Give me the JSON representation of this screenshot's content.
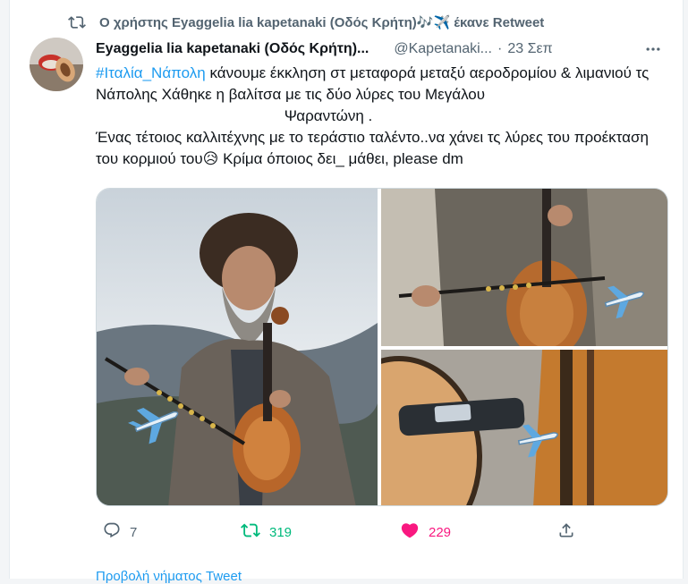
{
  "retweet_banner": {
    "text": "Ο χρήστης Eyaggelia lia kapetanaki (Οδός Κρήτη)🎶✈️ έκανε Retweet"
  },
  "tweet": {
    "author_name": "Eyaggelia lia kapetanaki (Οδός Κρήτη)...",
    "handle": "@Kapetanaki...",
    "date": "23 Σεπ",
    "hashtag": "#Ιταλία_Νάπολη",
    "line1_rest": " κάνουμε έκκληση στ μεταφορά μεταξύ αεροδρομίου & λιμανιού τς Νάπολης Χάθηκε η βαλίτσα με τις δύο λύρες του Μεγάλου",
    "line2": "Ψαραντώνη .",
    "line3": "Ένας τέτοιος καλλιτέχνης με το τεράστιο ταλέντο..να χάνει τς λύρες του προέκταση του κορμιού του😥 Κρίμα  όποιος δει_ μάθει, please dm"
  },
  "actions": {
    "reply_count": "7",
    "retweet_count": "319",
    "like_count": "229"
  },
  "footer": {
    "link_text": "Προβολή νήματος Tweet"
  },
  "colors": {
    "accent": "#1d9bf0",
    "retweet_active": "#00ba7c",
    "like_active": "#f91880",
    "secondary_text": "#536471"
  },
  "icons": {
    "retweet_banner": "retweet-icon",
    "more": "more-dots-icon",
    "reply": "reply-icon",
    "retweet": "retweet-icon",
    "like": "heart-icon",
    "share": "share-icon"
  }
}
